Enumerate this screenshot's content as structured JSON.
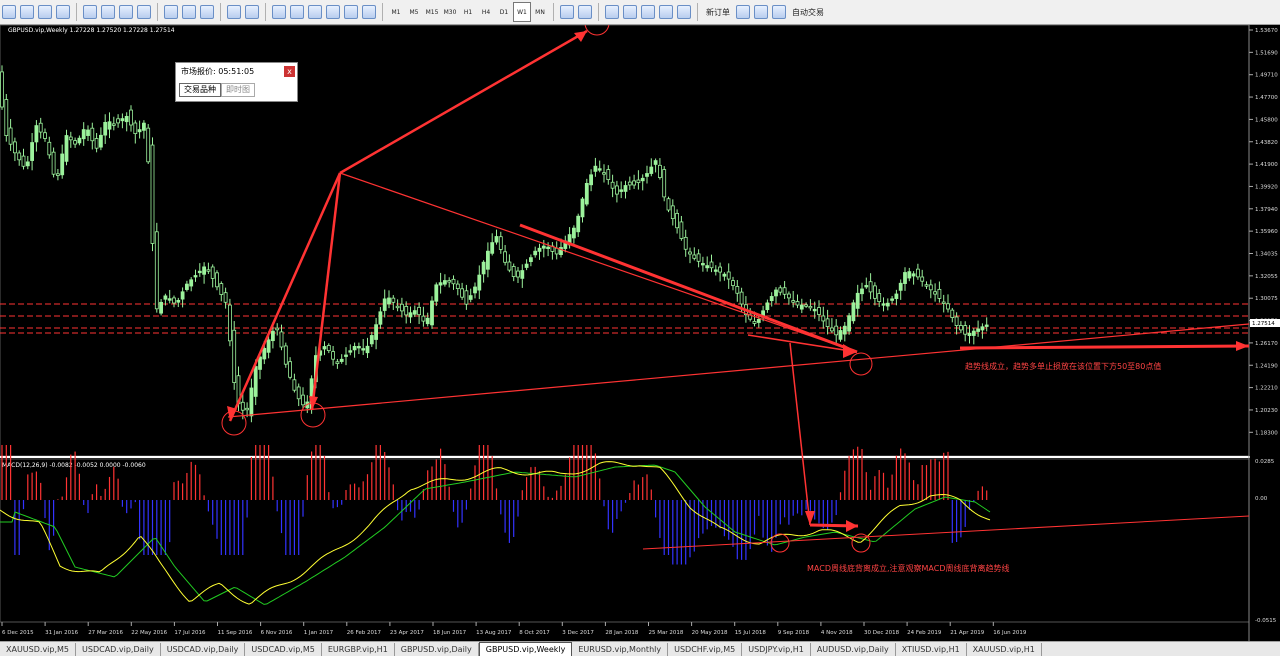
{
  "toolbar": {
    "timeframes": [
      "M1",
      "M5",
      "M15",
      "M30",
      "H1",
      "H4",
      "D1",
      "W1",
      "MN"
    ],
    "active_timeframe": "W1",
    "new_order_label": "新订单",
    "auto_trading_label": "自动交易"
  },
  "chart": {
    "title": "GBPUSD.vip,Weekly  1.27228 1.27520 1.27228 1.27514",
    "price_labels": [
      "1.53670",
      "1.51690",
      "1.49710",
      "1.47700",
      "1.45800",
      "1.43820",
      "1.41900",
      "1.39920",
      "1.37940",
      "1.35960",
      "1.34035",
      "1.32055",
      "1.30075",
      "1.28170",
      "1.26170",
      "1.24190",
      "1.22210",
      "1.20230",
      "1.18300"
    ],
    "current_price": "1.27514",
    "macd_title": "MACD(12,26,9) -0.0082 -0.0052 0.0000 -0.0060",
    "macd_labels": [
      "0.0285",
      "0.00",
      "-0.0515"
    ],
    "date_labels": [
      "6 Dec 2015",
      "31 Jan 2016",
      "27 Mar 2016",
      "22 May 2016",
      "17 Jul 2016",
      "11 Sep 2016",
      "6 Nov 2016",
      "1 Jan 2017",
      "26 Feb 2017",
      "23 Apr 2017",
      "18 Jun 2017",
      "13 Aug 2017",
      "8 Oct 2017",
      "3 Dec 2017",
      "28 Jan 2018",
      "25 Mar 2018",
      "20 May 2018",
      "15 Jul 2018",
      "9 Sep 2018",
      "4 Nov 2018",
      "30 Dec 2018",
      "24 Feb 2019",
      "21 Apr 2019",
      "16 Jun 2019"
    ],
    "annotation_trend": "趋势线成立，趋势多单止损放在该位置下方50至80点值",
    "annotation_macd": "MACD周线底背离成立,注意观察MACD周线底背离趋势线",
    "colors": {
      "bull": "#9cf29c",
      "bear": "#000000",
      "grid": "#1a1a1a",
      "annot": "#ff3333",
      "macd_pos": "#ff3333",
      "macd_neg": "#3333ff",
      "signal_main": "#ffff33",
      "signal_slow": "#22cc22"
    }
  },
  "quote_window": {
    "title": "市场报价: 05:51:05",
    "tab_symbols": "交易品种",
    "tab_ticks": "即时图",
    "close": "x"
  },
  "tabs": [
    "XAUUSD.vip,M5",
    "USDCAD.vip,Daily",
    "USDCAD.vip,Daily",
    "USDCAD.vip,M5",
    "EURGBP.vip,H1",
    "GBPUSD.vip,Daily",
    "GBPUSD.vip,Weekly",
    "EURUSD.vip,Monthly",
    "USDCHF.vip,M5",
    "USDJPY.vip,H1",
    "AUDUSD.vip,Daily",
    "XTIUSD.vip,H1",
    "XAUUSD.vip,H1"
  ],
  "active_tab": "GBPUSD.vip,Weekly"
}
